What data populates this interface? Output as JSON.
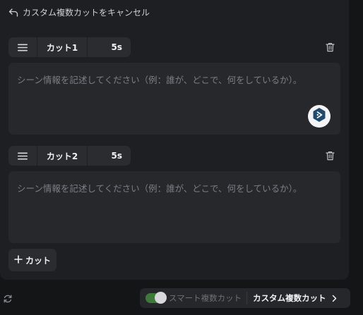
{
  "header": {
    "cancel_label": "カスタム複数カットをキャンセル"
  },
  "cuts": [
    {
      "name": "カット1",
      "duration": "5s",
      "placeholder": "シーン情報を記述してください（例：誰が、どこで、何をしているか）。",
      "value": ""
    },
    {
      "name": "カット2",
      "duration": "5s",
      "placeholder": "シーン情報を記述してください（例：誰が、どこで、何をしているか）。",
      "value": ""
    }
  ],
  "add_cut": {
    "label": "カット"
  },
  "footer": {
    "smart_toggle_on": true,
    "smart_label": "スマート複数カット",
    "custom_label": "カスタム複数カット"
  },
  "colors": {
    "toggle_on": "#3d7a3a",
    "assist_icon": "#1f4a6e"
  },
  "icons": {
    "back": "arrow-back-icon",
    "drag": "drag-handle-icon",
    "delete": "trash-icon",
    "assist": "ai-assist-icon",
    "add": "plus-icon",
    "refresh": "refresh-icon",
    "next": "chevron-right-icon"
  }
}
